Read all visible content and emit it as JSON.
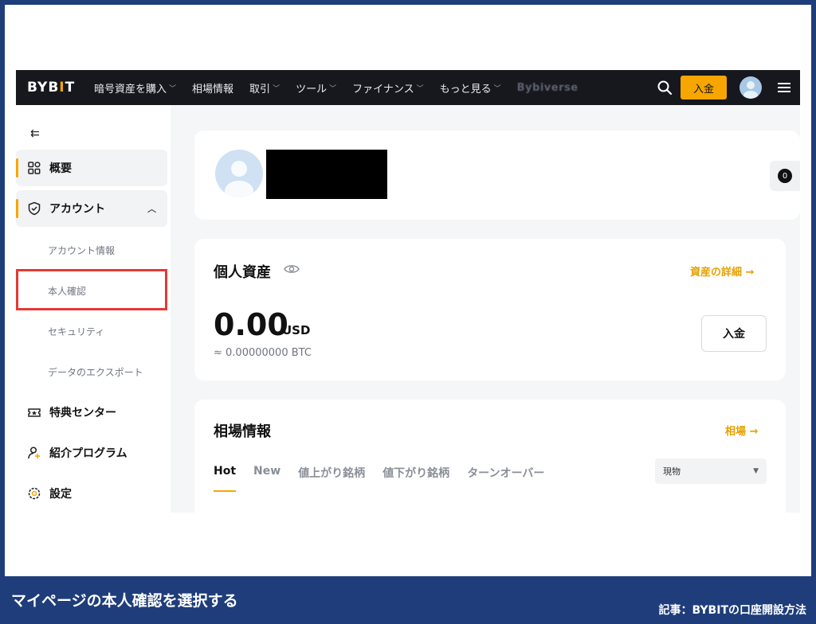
{
  "nav": {
    "logo_prefix": "BYB",
    "logo_bar": "I",
    "logo_suffix": "T",
    "items": [
      {
        "label": "暗号資産を購入",
        "has_chevron": true
      },
      {
        "label": "相場情報",
        "has_chevron": false
      },
      {
        "label": "取引",
        "has_chevron": true
      },
      {
        "label": "ツール",
        "has_chevron": true
      },
      {
        "label": "ファイナンス",
        "has_chevron": true
      },
      {
        "label": "もっと見る",
        "has_chevron": true
      },
      {
        "label": "Bybiverse",
        "has_chevron": false
      }
    ],
    "deposit_label": "入金",
    "accent_color": "#f7a600"
  },
  "sidebar": {
    "overview": "概要",
    "account": "アカウント",
    "sub_items": [
      "アカウント情報",
      "本人確認",
      "セキュリティ",
      "データのエクスポート"
    ],
    "rewards": "特典センター",
    "referral": "紹介プログラム",
    "settings": "設定"
  },
  "profile": {
    "badge_count": "0"
  },
  "assets": {
    "title": "個人資産",
    "details_link": "資産の詳細 →",
    "balance": "0.00",
    "unit": "USD",
    "btc_equiv": "≈ 0.00000000 BTC",
    "deposit_label": "入金"
  },
  "market": {
    "title": "相場情報",
    "link": "相場 →",
    "tabs": [
      "Hot",
      "New",
      "値上がり銘柄",
      "値下がり銘柄",
      "ターンオーバー"
    ],
    "select_value": "現物"
  },
  "caption": {
    "left": "マイページの本人確認を選択する",
    "right": "記事：BYBITの口座開設方法"
  }
}
